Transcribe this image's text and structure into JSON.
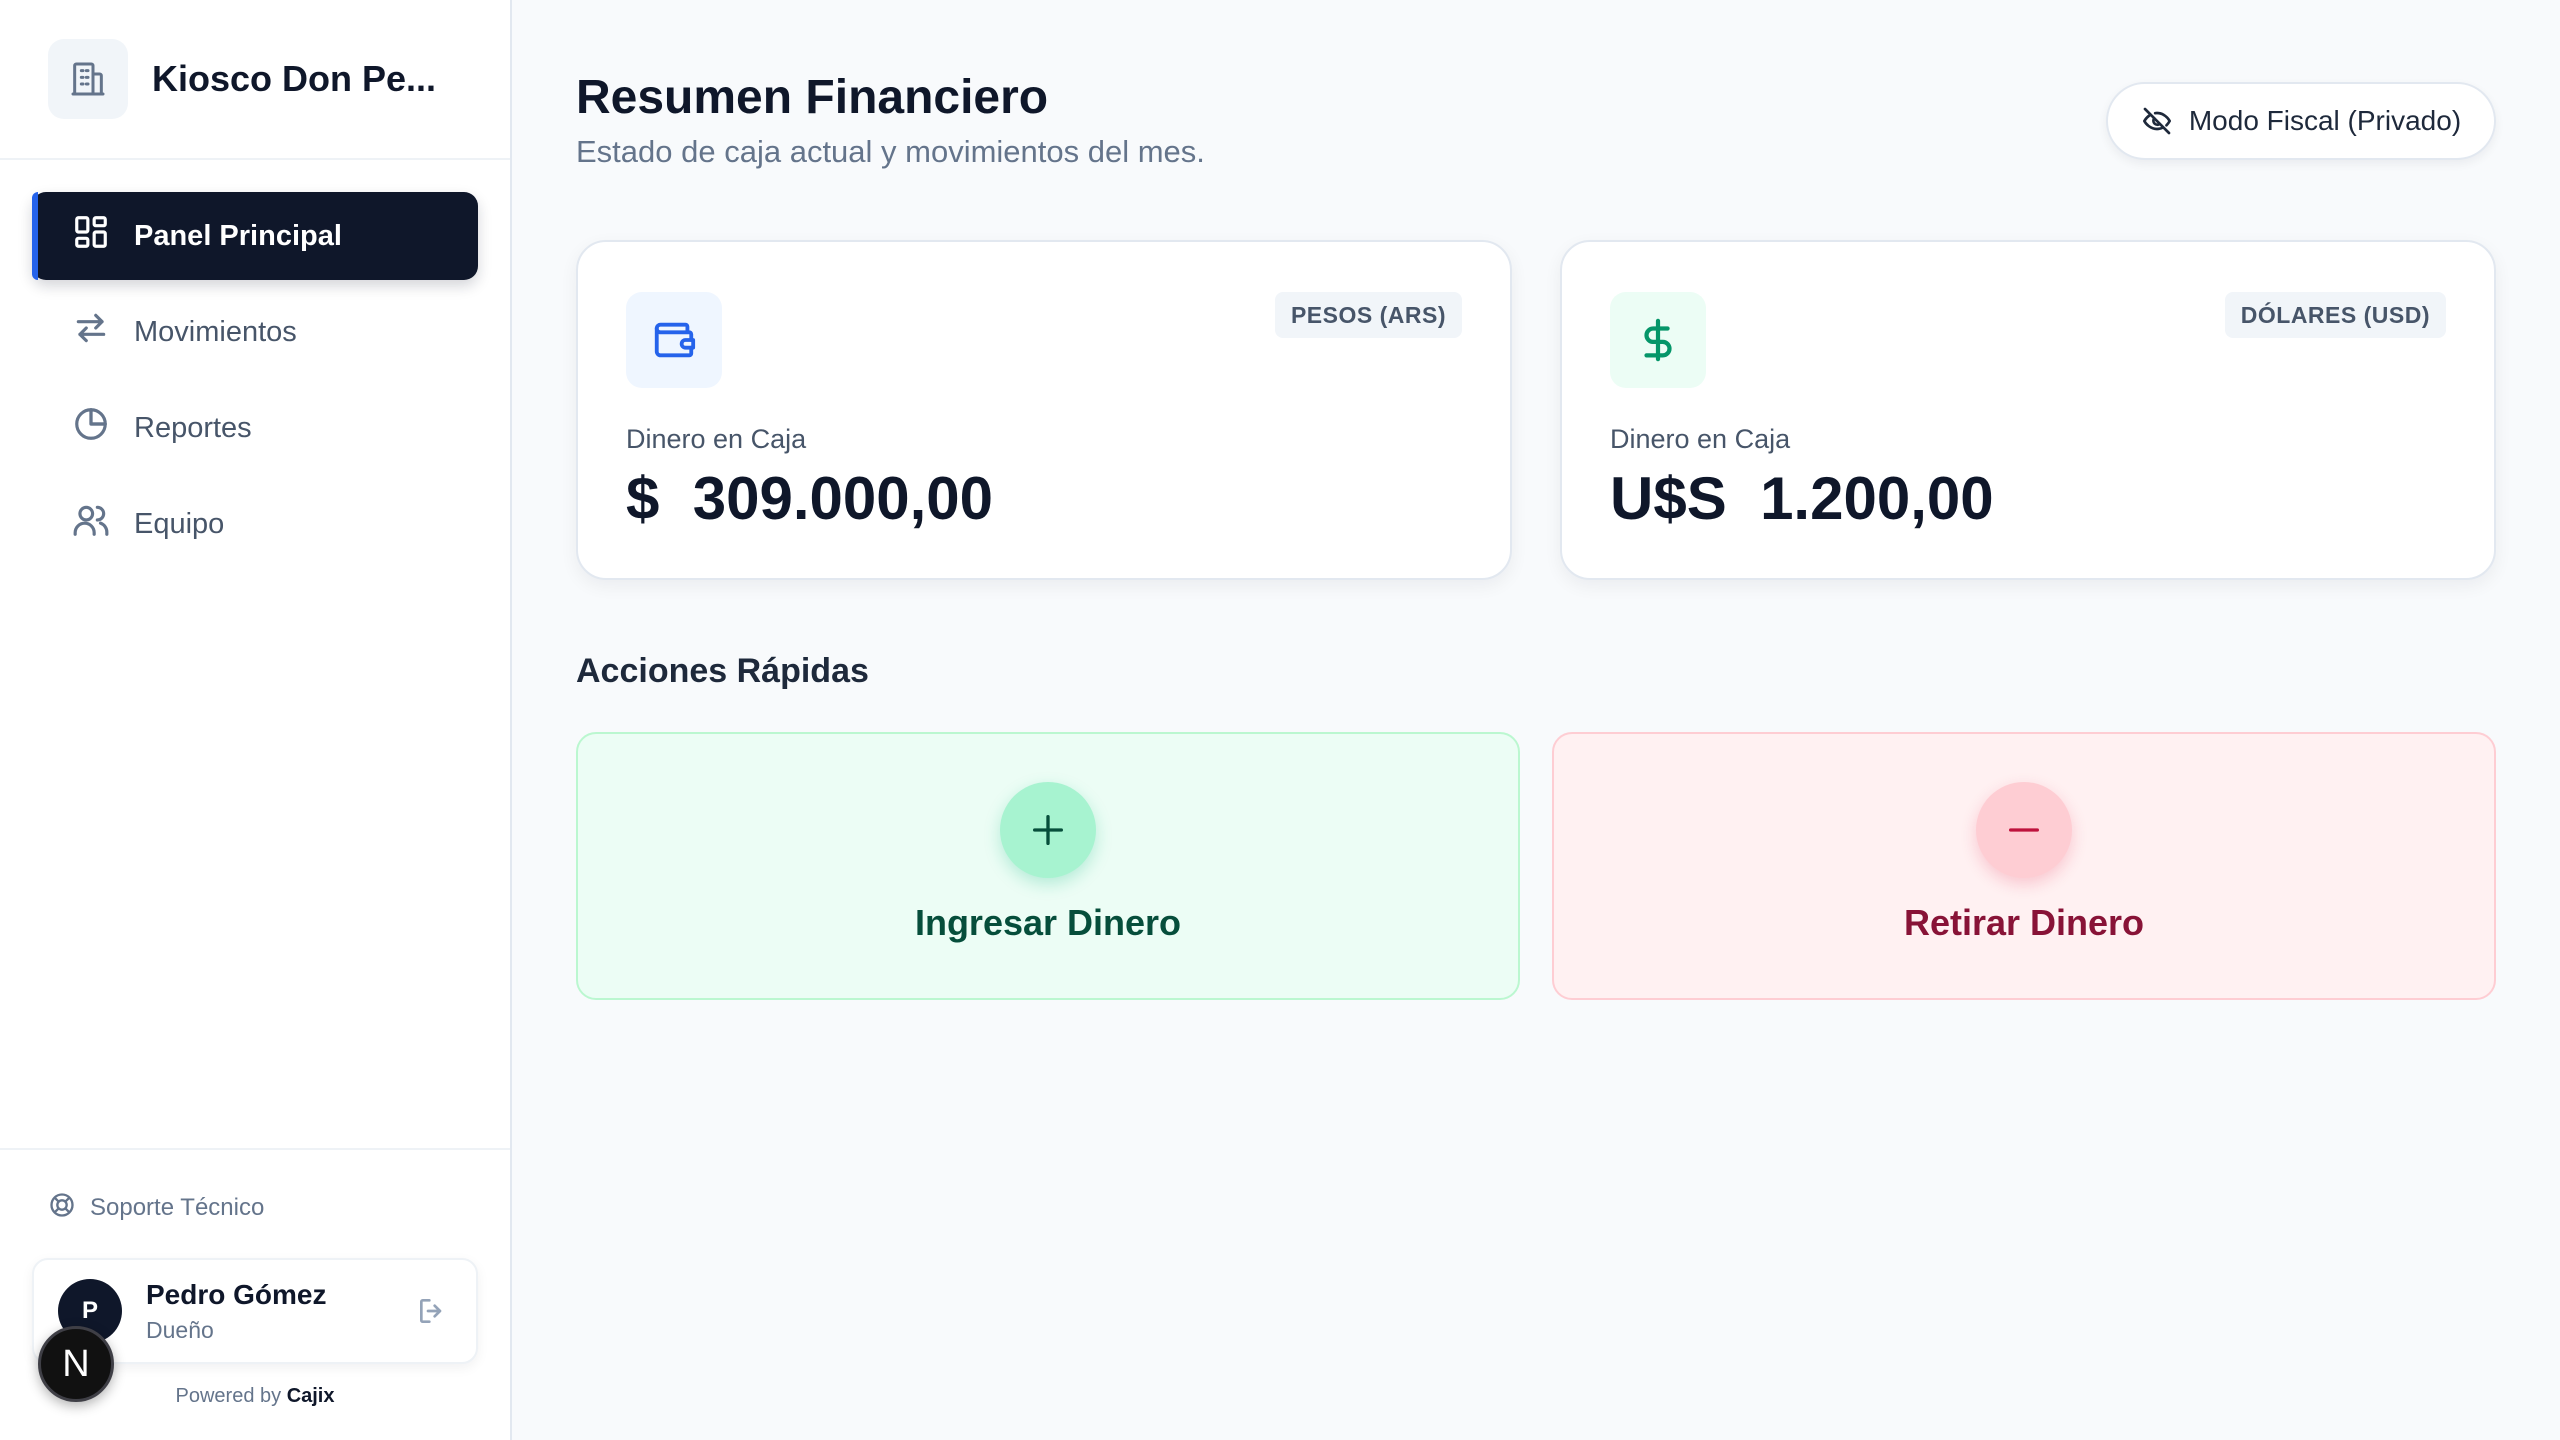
{
  "colors": {
    "primary": "#0f172a",
    "accent_blue": "#2563eb",
    "green": "#059669",
    "red": "#be123c"
  },
  "sidebar": {
    "brand": {
      "name": "Kiosco Don Pe...",
      "icon": "building-icon"
    },
    "nav": [
      {
        "label": "Panel Principal",
        "icon": "dashboard-grid-icon",
        "active": true
      },
      {
        "label": "Movimientos",
        "icon": "arrows-exchange-icon",
        "active": false
      },
      {
        "label": "Reportes",
        "icon": "pie-chart-icon",
        "active": false
      },
      {
        "label": "Equipo",
        "icon": "users-icon",
        "active": false
      }
    ],
    "support_label": "Soporte Técnico",
    "user": {
      "initial": "P",
      "name": "Pedro Gómez",
      "role": "Dueño"
    },
    "badge_letter": "N",
    "powered_prefix": "Powered by",
    "powered_brand": "Cajix"
  },
  "header": {
    "title": "Resumen Financiero",
    "subtitle": "Estado de caja actual y movimientos del mes.",
    "fiscal_button": "Modo Fiscal (Privado)"
  },
  "cards": [
    {
      "badge": "PESOS (ARS)",
      "label": "Dinero en Caja",
      "symbol": "$",
      "amount": "309.000,00",
      "icon": "wallet-icon"
    },
    {
      "badge": "DÓLARES (USD)",
      "label": "Dinero en Caja",
      "symbol": "U$S",
      "amount": "1.200,00",
      "icon": "dollar-icon"
    }
  ],
  "quick_actions": {
    "title": "Acciones Rápidas",
    "deposit": "Ingresar Dinero",
    "withdraw": "Retirar Dinero"
  }
}
